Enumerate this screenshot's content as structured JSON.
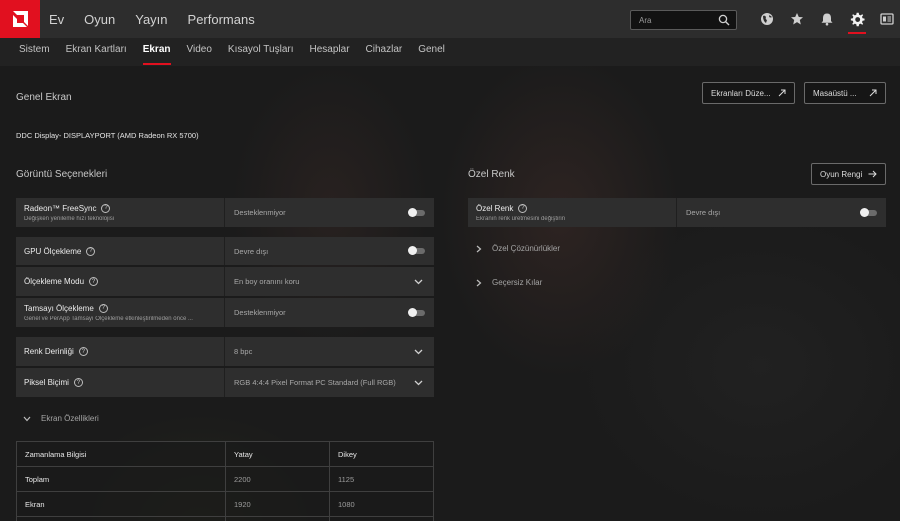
{
  "nav": {
    "items": [
      "Ev",
      "Oyun",
      "Yayın",
      "Performans"
    ],
    "search_placeholder": "Ara"
  },
  "subnav": {
    "tabs": [
      "Sistem",
      "Ekran Kartları",
      "Ekran",
      "Video",
      "Kısayol Tuşları",
      "Hesaplar",
      "Cihazlar",
      "Genel"
    ],
    "active": "Ekran"
  },
  "general": {
    "title": "Genel Ekran",
    "display_name": "DDC Display- DISPLAYPORT (AMD Radeon RX 5700)",
    "btn_displays": "Ekranları Düze...",
    "btn_desktop": "Masaüstü ..."
  },
  "display_options": {
    "title": "Görüntü Seçenekleri",
    "rows": [
      {
        "label": "Radeon™ FreeSync",
        "sub": "Değişken yenileme hızı teknolojisi",
        "value": "Desteklenmiyor",
        "control": "toggle"
      },
      {
        "label": "GPU Ölçekleme",
        "sub": "",
        "value": "Devre dışı",
        "control": "toggle"
      },
      {
        "label": "Ölçekleme Modu",
        "sub": "",
        "value": "En boy oranını koru",
        "control": "dropdown"
      },
      {
        "label": "Tamsayı Ölçekleme",
        "sub": "Genel ve PerApp Tamsayı Ölçekleme etkinleştirilmeden önce ...",
        "value": "Desteklenmiyor",
        "control": "toggle"
      },
      {
        "label": "Renk Derinliği",
        "sub": "",
        "value": "8 bpc",
        "control": "dropdown"
      },
      {
        "label": "Piksel Biçimi",
        "sub": "",
        "value": "RGB 4:4:4 Pixel Format PC Standard (Full RGB)",
        "control": "dropdown"
      }
    ],
    "screen_props": "Ekran Özellikleri"
  },
  "custom_color": {
    "title": "Özel Renk",
    "btn_game_color": "Oyun Rengi",
    "label": "Özel Renk",
    "sub": "Ekranın renk üretmesini değiştirin",
    "value": "Devre dışı",
    "custom_resolutions": "Özel Çözünürlükler",
    "override": "Geçersiz Kılar"
  },
  "timing": {
    "headers": [
      "Zamanlama Bilgisi",
      "Yatay",
      "Dikey"
    ],
    "rows": [
      [
        "Toplam",
        "2200",
        "1125"
      ],
      [
        "Ekran",
        "1920",
        "1080"
      ],
      [
        "",
        "",
        ""
      ]
    ]
  },
  "colors": {
    "accent": "#e1101f",
    "topbar": "#2d2d2d",
    "panel_row": "#2e2e2e"
  }
}
